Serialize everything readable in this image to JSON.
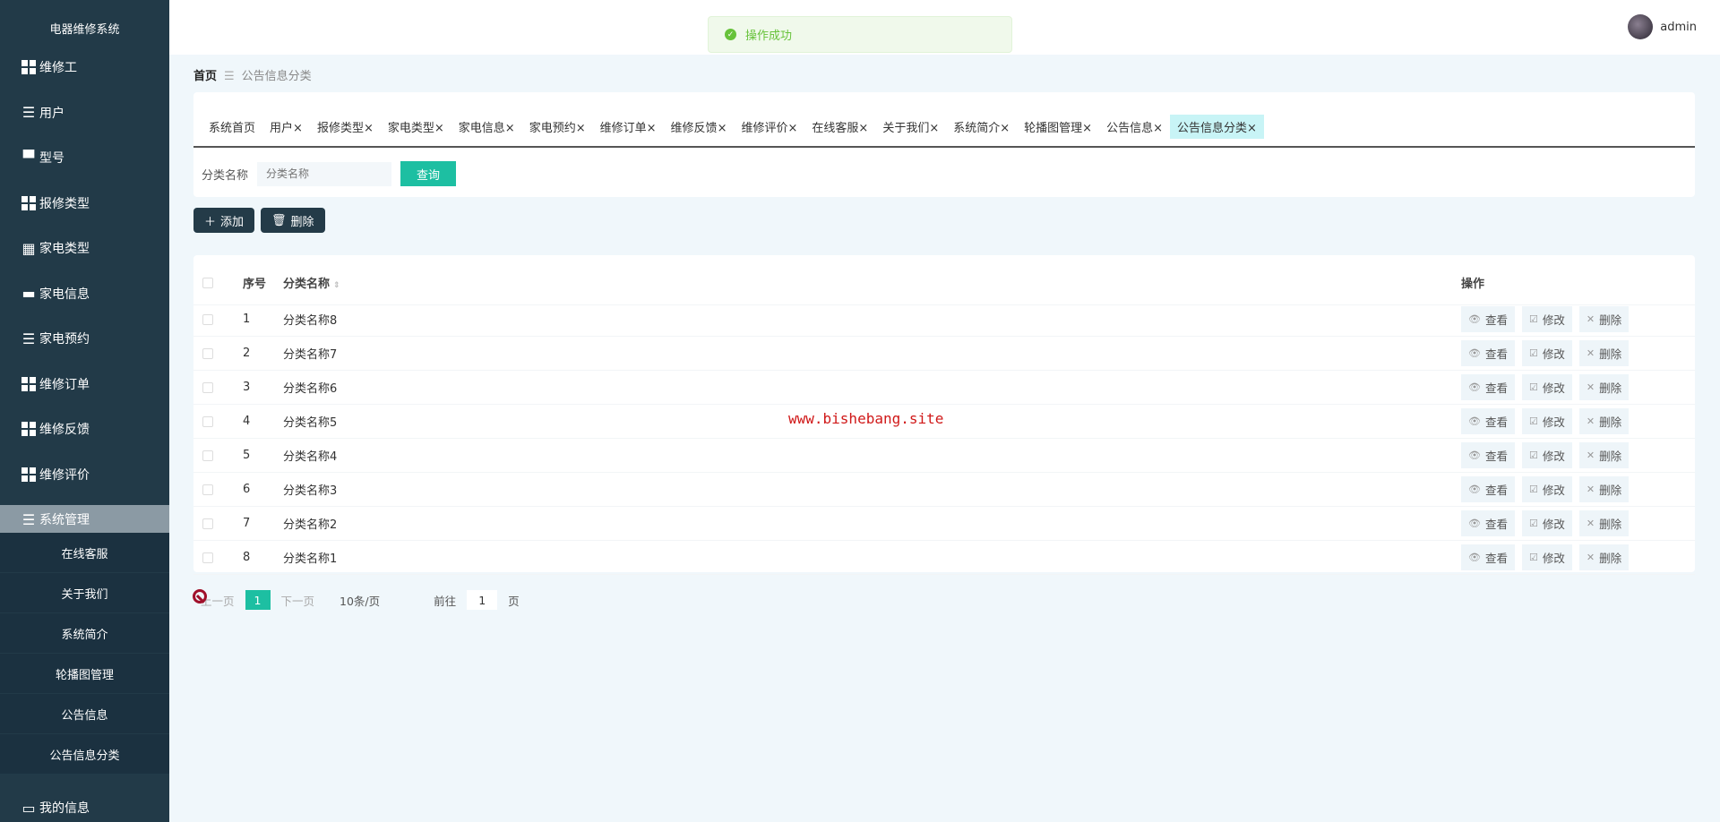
{
  "app": {
    "title": "电器维修系统"
  },
  "sidebar": {
    "items": [
      {
        "label": "维修工",
        "icon": "grid-icon"
      },
      {
        "label": "用户",
        "icon": "sliders-icon"
      },
      {
        "label": "型号",
        "icon": "monitor-icon"
      },
      {
        "label": "报修类型",
        "icon": "grid-icon"
      },
      {
        "label": "家电类型",
        "icon": "grid9-icon"
      },
      {
        "label": "家电信息",
        "icon": "wallet-icon"
      },
      {
        "label": "家电预约",
        "icon": "list-icon"
      },
      {
        "label": "维修订单",
        "icon": "grid-icon"
      },
      {
        "label": "维修反馈",
        "icon": "grid-icon"
      },
      {
        "label": "维修评价",
        "icon": "grid-icon"
      },
      {
        "label": "系统管理",
        "icon": "list-icon"
      }
    ],
    "sub_items": [
      "在线客服",
      "关于我们",
      "系统简介",
      "轮播图管理",
      "公告信息",
      "公告信息分类"
    ],
    "bottom": {
      "label": "我的信息",
      "icon": "card-icon"
    }
  },
  "toast": {
    "message": "操作成功"
  },
  "user": {
    "name": "admin"
  },
  "breadcrumb": {
    "home": "首页",
    "current": "公告信息分类"
  },
  "tabs": [
    "系统首页",
    "用户",
    "报修类型",
    "家电类型",
    "家电信息",
    "家电预约",
    "维修订单",
    "维修反馈",
    "维修评价",
    "在线客服",
    "关于我们",
    "系统简介",
    "轮播图管理",
    "公告信息",
    "公告信息分类"
  ],
  "search": {
    "label": "分类名称",
    "placeholder": "分类名称",
    "button": "查询"
  },
  "actions": {
    "add": "添加",
    "delete": "删除"
  },
  "table": {
    "headers": {
      "index": "序号",
      "name": "分类名称",
      "ops": "操作"
    },
    "rows": [
      {
        "i": "1",
        "name": "分类名称8"
      },
      {
        "i": "2",
        "name": "分类名称7"
      },
      {
        "i": "3",
        "name": "分类名称6"
      },
      {
        "i": "4",
        "name": "分类名称5"
      },
      {
        "i": "5",
        "name": "分类名称4"
      },
      {
        "i": "6",
        "name": "分类名称3"
      },
      {
        "i": "7",
        "name": "分类名称2"
      },
      {
        "i": "8",
        "name": "分类名称1"
      }
    ],
    "ops": {
      "view": "查看",
      "edit": "修改",
      "delete": "删除"
    }
  },
  "pagination": {
    "prev": "上一页",
    "current": "1",
    "next": "下一页",
    "size": "10条/页",
    "goto": "前往",
    "page": "1",
    "unit": "页"
  },
  "watermark": "www.bishebang.site"
}
